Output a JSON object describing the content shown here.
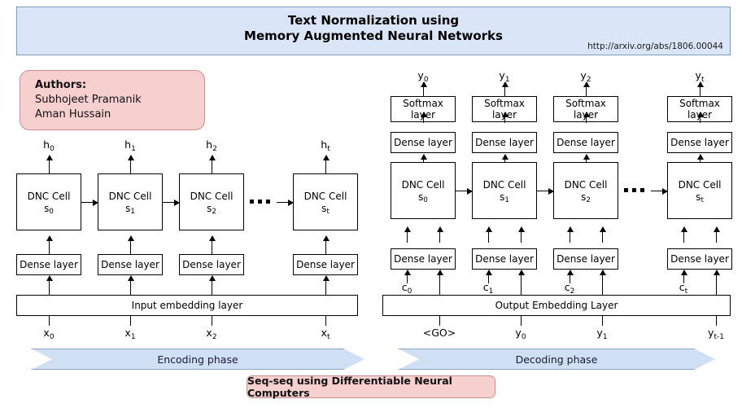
{
  "header": {
    "title_line1": "Text Normalization using",
    "title_line2": "Memory Augmented Neural Networks",
    "url": "http://arxiv.org/abs/1806.00044",
    "banner_color": "#dae6f7"
  },
  "authors": {
    "heading": "Authors:",
    "name1": "Subhojeet Pramanik",
    "name2": "Aman Hussain",
    "card_color": "#f6cfcf"
  },
  "encoder": {
    "phase_label": "Encoding phase",
    "embedding_label": "Input embedding layer",
    "dense_label": "Dense layer",
    "cell_label": "DNC Cell",
    "ellipsis": "▪ ▪ ▪",
    "columns": [
      {
        "state": "s",
        "state_sub": "0",
        "output": "h",
        "output_sub": "0",
        "input": "x",
        "input_sub": "0"
      },
      {
        "state": "s",
        "state_sub": "1",
        "output": "h",
        "output_sub": "1",
        "input": "x",
        "input_sub": "1"
      },
      {
        "state": "s",
        "state_sub": "2",
        "output": "h",
        "output_sub": "2",
        "input": "x",
        "input_sub": "2"
      },
      {
        "state": "s",
        "state_sub": "t",
        "output": "h",
        "output_sub": "t",
        "input": "x",
        "input_sub": "t"
      }
    ]
  },
  "decoder": {
    "phase_label": "Decoding phase",
    "embedding_label": "Output Embedding Layer",
    "dense_label": "Dense layer",
    "softmax_line1": "Softmax",
    "softmax_line2": "layer",
    "cell_label": "DNC Cell",
    "ellipsis": "▪ ▪ ▪",
    "columns": [
      {
        "state": "s",
        "state_sub": "0",
        "output": "y",
        "output_sub": "0",
        "context": "c",
        "context_sub": "0",
        "input": "<GO>",
        "input_sub": ""
      },
      {
        "state": "s",
        "state_sub": "1",
        "output": "y",
        "output_sub": "1",
        "context": "c",
        "context_sub": "1",
        "input": "y",
        "input_sub": "0"
      },
      {
        "state": "s",
        "state_sub": "2",
        "output": "y",
        "output_sub": "2",
        "context": "c",
        "context_sub": "2",
        "input": "y",
        "input_sub": "1"
      },
      {
        "state": "s",
        "state_sub": "t",
        "output": "y",
        "output_sub": "t",
        "context": "c",
        "context_sub": "t",
        "input": "y",
        "input_sub": "t-1"
      }
    ]
  },
  "footer": {
    "caption": "Seq-seq using Differentiable Neural Computers",
    "caption_color": "#f6cfcf"
  }
}
